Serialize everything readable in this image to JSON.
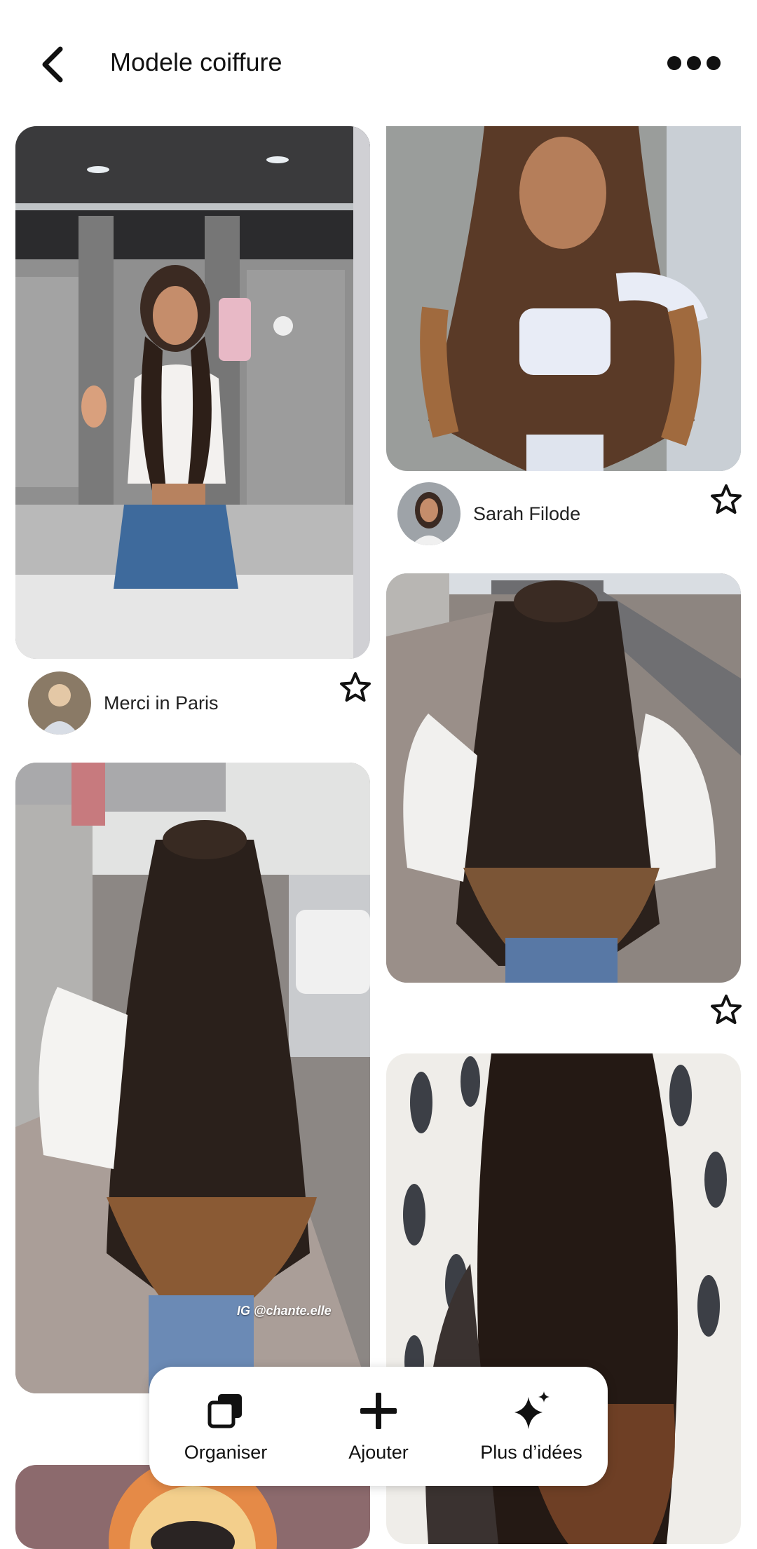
{
  "header": {
    "title": "Modele coiffure",
    "back_icon": "chevron-left-icon",
    "more_icon": "ellipsis-icon"
  },
  "pins": [
    {
      "author": "Merci in Paris",
      "image": "mirror-selfie-braids",
      "saved_icon": "star-outline-icon"
    },
    {
      "author": "Sarah Filode",
      "image": "curly-braids-portrait",
      "saved_icon": "star-outline-icon"
    },
    {
      "author": "",
      "image": "street-braids-back-view",
      "saved_icon": "star-outline-icon"
    },
    {
      "author": "",
      "image": "sidewalk-braids-back-view",
      "overlay_text": "IG @chante.elle"
    },
    {
      "author": "",
      "image": "patterned-wall-braids"
    }
  ],
  "dock": {
    "organize": "Organiser",
    "add": "Ajouter",
    "more_ideas": "Plus d’idées"
  },
  "colors": {
    "background": "#ffffff",
    "text": "#111111"
  }
}
